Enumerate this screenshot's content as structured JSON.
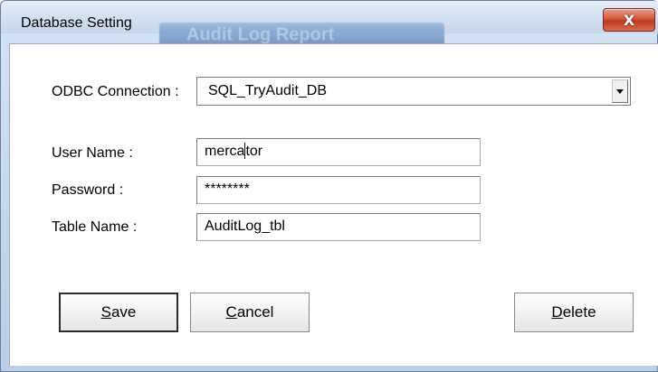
{
  "window": {
    "title": "Database Setting",
    "background_title": "Audit Log Report",
    "close_glyph": "X"
  },
  "form": {
    "odbc": {
      "label": "ODBC Connection :",
      "value": "SQL_TryAudit_DB"
    },
    "user_name": {
      "label": "User Name :",
      "value_before_caret": "merca",
      "value_after_caret": "tor"
    },
    "password": {
      "label": "Password :",
      "value": "********"
    },
    "table_name": {
      "label": "Table Name :",
      "value": "AuditLog_tbl"
    }
  },
  "buttons": {
    "save": {
      "mnemonic": "S",
      "rest": "ave"
    },
    "cancel": {
      "mnemonic": "C",
      "rest": "ancel"
    },
    "delete": {
      "mnemonic": "D",
      "rest": "elete"
    }
  },
  "colors": {
    "title_gradient_top": "#e6eef8",
    "close_button_red": "#c03a1f",
    "client_bg": "#ffffff"
  },
  "icons": {
    "close": "close-icon",
    "dropdown": "chevron-down-icon"
  }
}
